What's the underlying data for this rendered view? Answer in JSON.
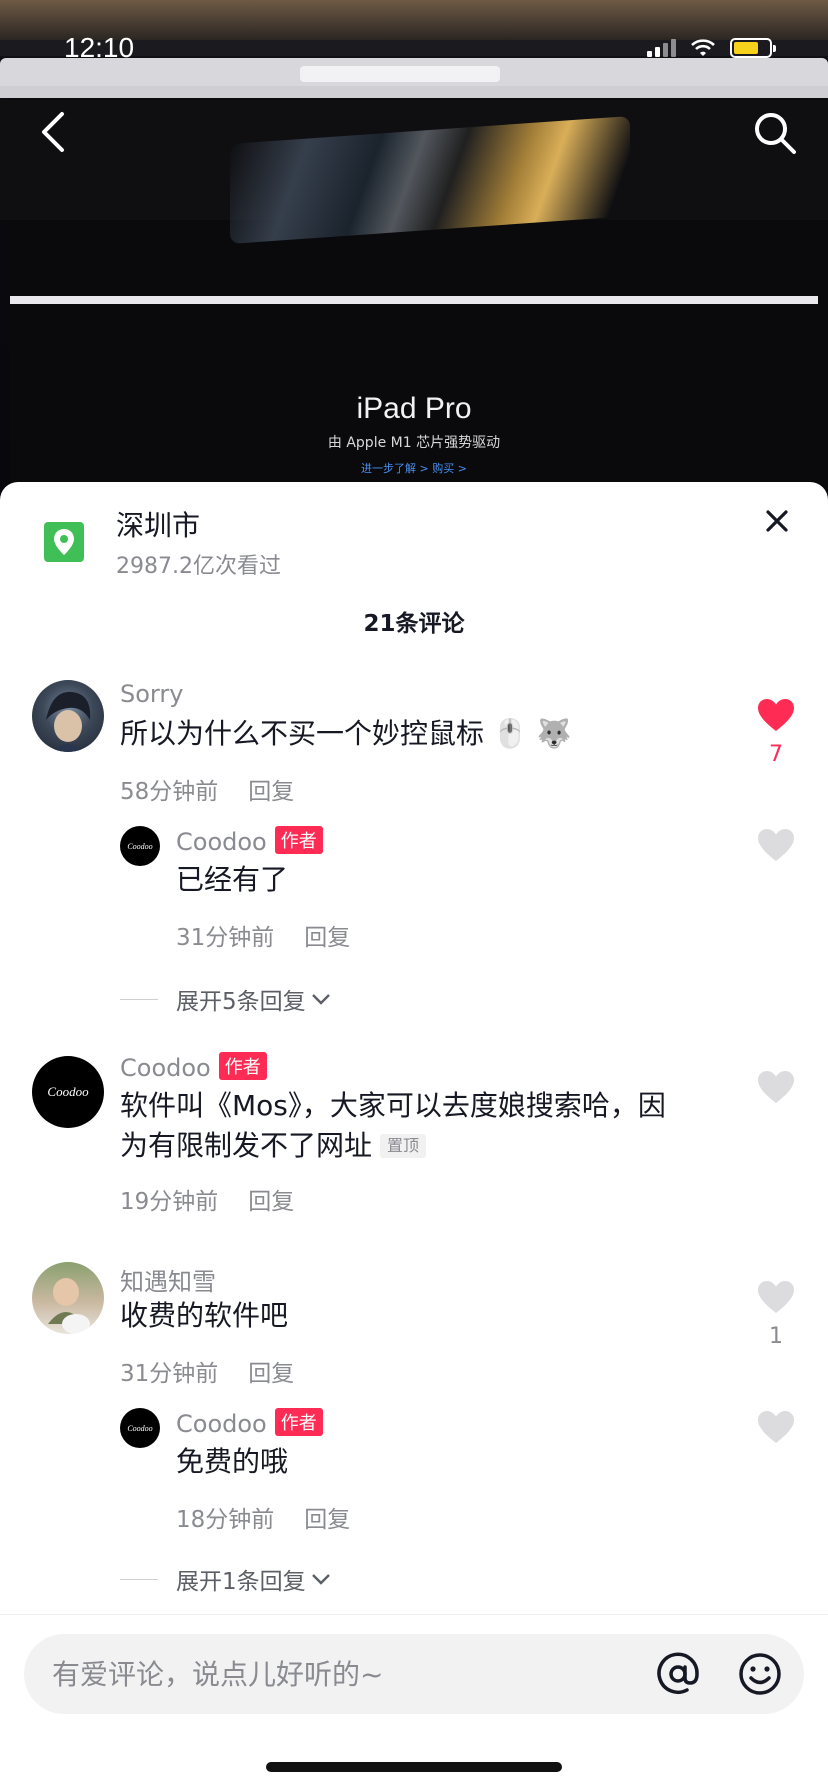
{
  "status_bar": {
    "time": "12:10"
  },
  "video": {
    "ipad_title": "iPad Pro",
    "ipad_subtitle": "由 Apple M1 芯片强势驱动",
    "ipad_links": "进一步了解 >    购买 >"
  },
  "sheet": {
    "location_title": "深圳市",
    "location_views": "2987.2亿次看过",
    "comment_count": "21条评论"
  },
  "comments": [
    {
      "name": "Sorry",
      "text": "所以为什么不买一个妙控鼠标 🖱️ 🐺",
      "time": "58分钟前",
      "reply": "回复",
      "likes": "7",
      "liked": true
    },
    {
      "name": "Coodoo",
      "badge": "作者",
      "text": "已经有了",
      "time": "31分钟前",
      "reply": "回复"
    },
    {
      "expand": "展开5条回复"
    },
    {
      "name": "Coodoo",
      "badge": "作者",
      "text_line1": "软件叫《Mos》，大家可以去度娘搜索哈，因",
      "text_line2": "为有限制发不了网址",
      "pin": "置顶",
      "time": "19分钟前",
      "reply": "回复"
    },
    {
      "name": "知遇知雪",
      "text": "收费的软件吧",
      "time": "31分钟前",
      "reply": "回复",
      "likes": "1"
    },
    {
      "name": "Coodoo",
      "badge": "作者",
      "text": "免费的哦",
      "time": "18分钟前",
      "reply": "回复"
    },
    {
      "expand": "展开1条回复"
    }
  ],
  "avatar_logo_text": "Coodoo",
  "input": {
    "placeholder": "有爱评论，说点儿好听的~"
  },
  "colors": {
    "accent": "#fe2c55",
    "location_green": "#3fbf55",
    "muted": "#8a8b91"
  }
}
